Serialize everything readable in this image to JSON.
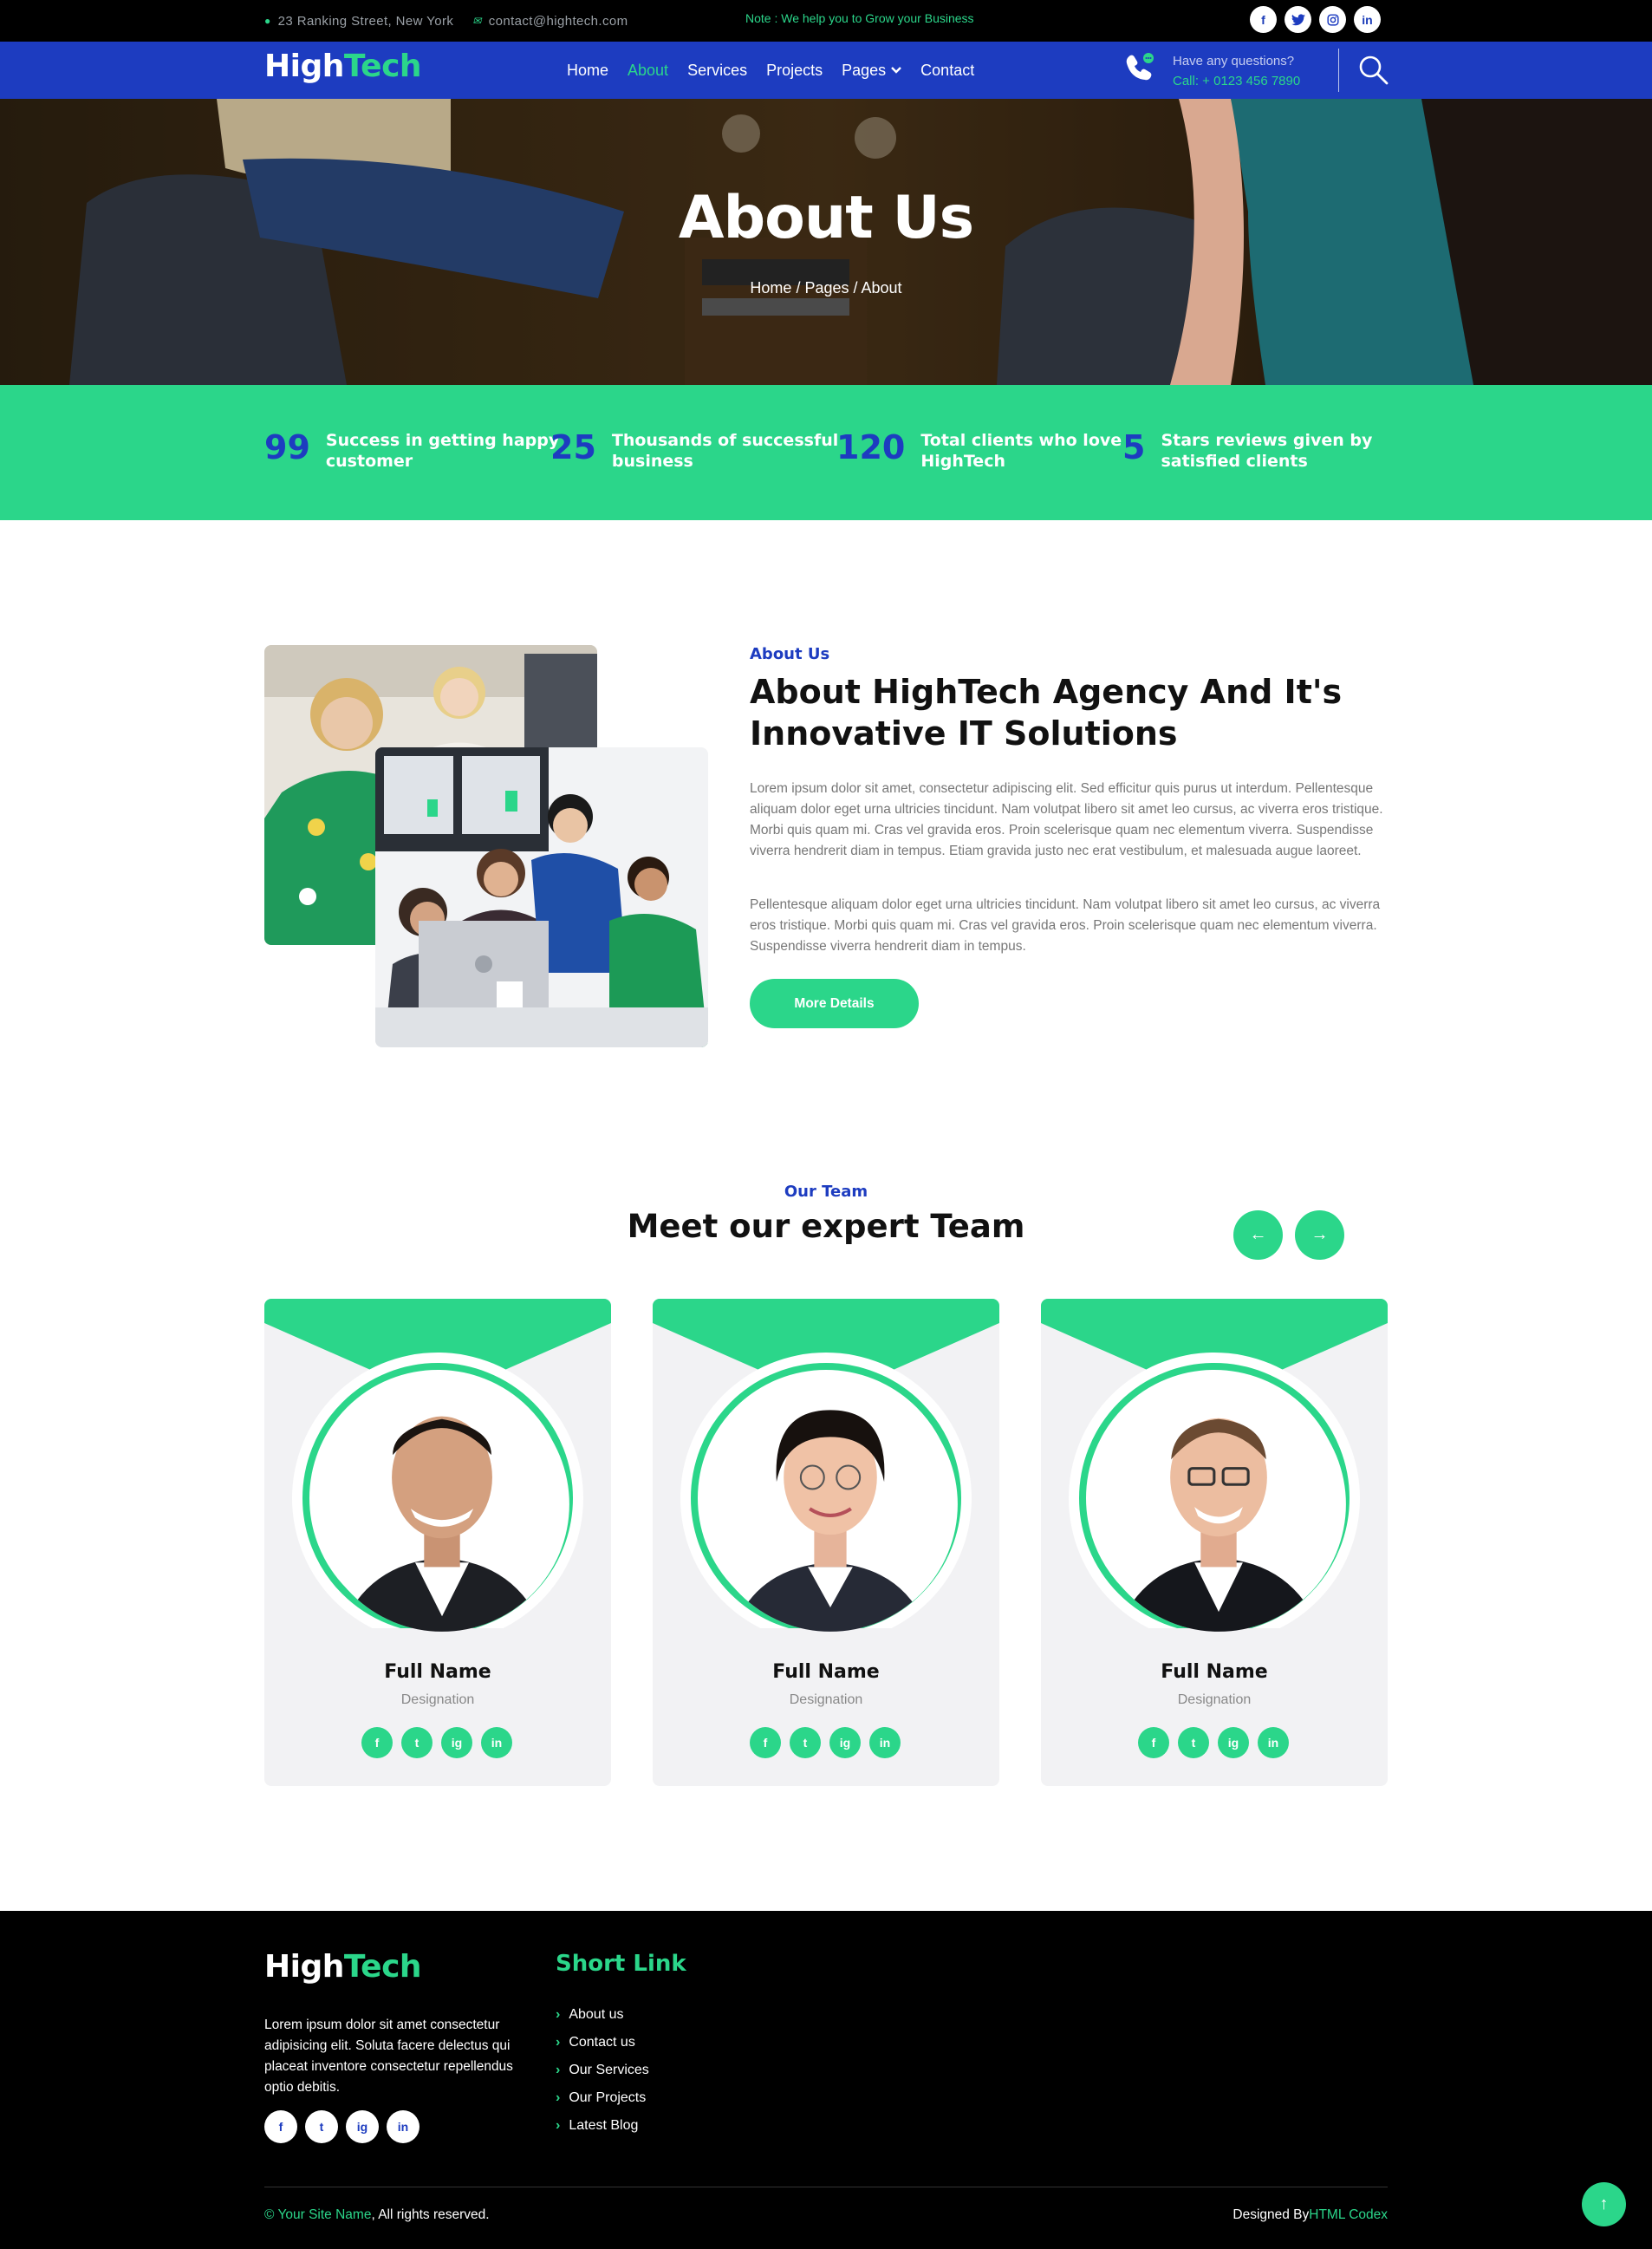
{
  "topbar": {
    "address": "23 Ranking Street, New York",
    "email": "contact@hightech.com",
    "note": "Note : We help you to Grow your Business",
    "social": [
      "f",
      "t",
      "ig",
      "in"
    ]
  },
  "nav": {
    "logo_a": "High",
    "logo_b": "Tech",
    "items": [
      "Home",
      "About",
      "Services",
      "Projects",
      "Pages",
      "Contact"
    ],
    "active": "About",
    "question": "Have any questions?",
    "call": "Call: + 0123 456 7890"
  },
  "hero": {
    "title": "About Us",
    "breadcrumb": [
      "Home",
      "Pages",
      "About"
    ]
  },
  "counters": [
    {
      "num": "99",
      "label_1": "Success in getting happy",
      "label_2": "customer"
    },
    {
      "num": "25",
      "label_1": "Thousands of successful",
      "label_2": "business"
    },
    {
      "num": "120",
      "label_1": "Total clients who love",
      "label_2": "HighTech"
    },
    {
      "num": "5",
      "label_1": "Stars reviews given by",
      "label_2": "satisfied clients"
    }
  ],
  "about": {
    "subtitle": "About Us",
    "title_1": "About HighTech Agency And It's",
    "title_2": "Innovative IT Solutions",
    "para1": "Lorem ipsum dolor sit amet, consectetur adipiscing elit. Sed efficitur quis purus ut interdum. Pellentesque aliquam dolor eget urna ultricies tincidunt. Nam volutpat libero sit amet leo cursus, ac viverra eros tristique. Morbi quis quam mi. Cras vel gravida eros. Proin scelerisque quam nec elementum viverra. Suspendisse viverra hendrerit diam in tempus. Etiam gravida justo nec erat vestibulum, et malesuada augue laoreet.",
    "para2": "Pellentesque aliquam dolor eget urna ultricies tincidunt. Nam volutpat libero sit amet leo cursus, ac viverra eros tristique. Morbi quis quam mi. Cras vel gravida eros. Proin scelerisque quam nec elementum viverra. Suspendisse viverra hendrerit diam in tempus.",
    "button": "More Details"
  },
  "team": {
    "subtitle": "Our Team",
    "title": "Meet our expert Team",
    "prev": "←",
    "next": "→",
    "members": [
      {
        "name": "Full Name",
        "designation": "Designation"
      },
      {
        "name": "Full Name",
        "designation": "Designation"
      },
      {
        "name": "Full Name",
        "designation": "Designation"
      }
    ]
  },
  "footer": {
    "text": "Lorem ipsum dolor sit amet consectetur adipisicing elit. Soluta facere delectus qui placeat inventore consectetur repellendus optio debitis.",
    "short_link_title": "Short Link",
    "links": [
      "About us",
      "Contact us",
      "Our Services",
      "Our Projects",
      "Latest Blog"
    ],
    "copyright_site": "Your Site Name",
    "copyright_rest": ", All rights reserved.",
    "designed_by": "Designed By",
    "designer": "HTML Codex"
  },
  "colors": {
    "accent": "#2bd68a",
    "primary": "#1d3cc0",
    "dark": "#000000"
  },
  "icons": [
    "map-marker-icon",
    "envelope-icon",
    "facebook-icon",
    "twitter-icon",
    "instagram-icon",
    "linkedin-icon",
    "phone-icon",
    "search-icon",
    "chevron-down-icon",
    "arrow-left-icon",
    "arrow-right-icon",
    "arrow-up-icon"
  ]
}
